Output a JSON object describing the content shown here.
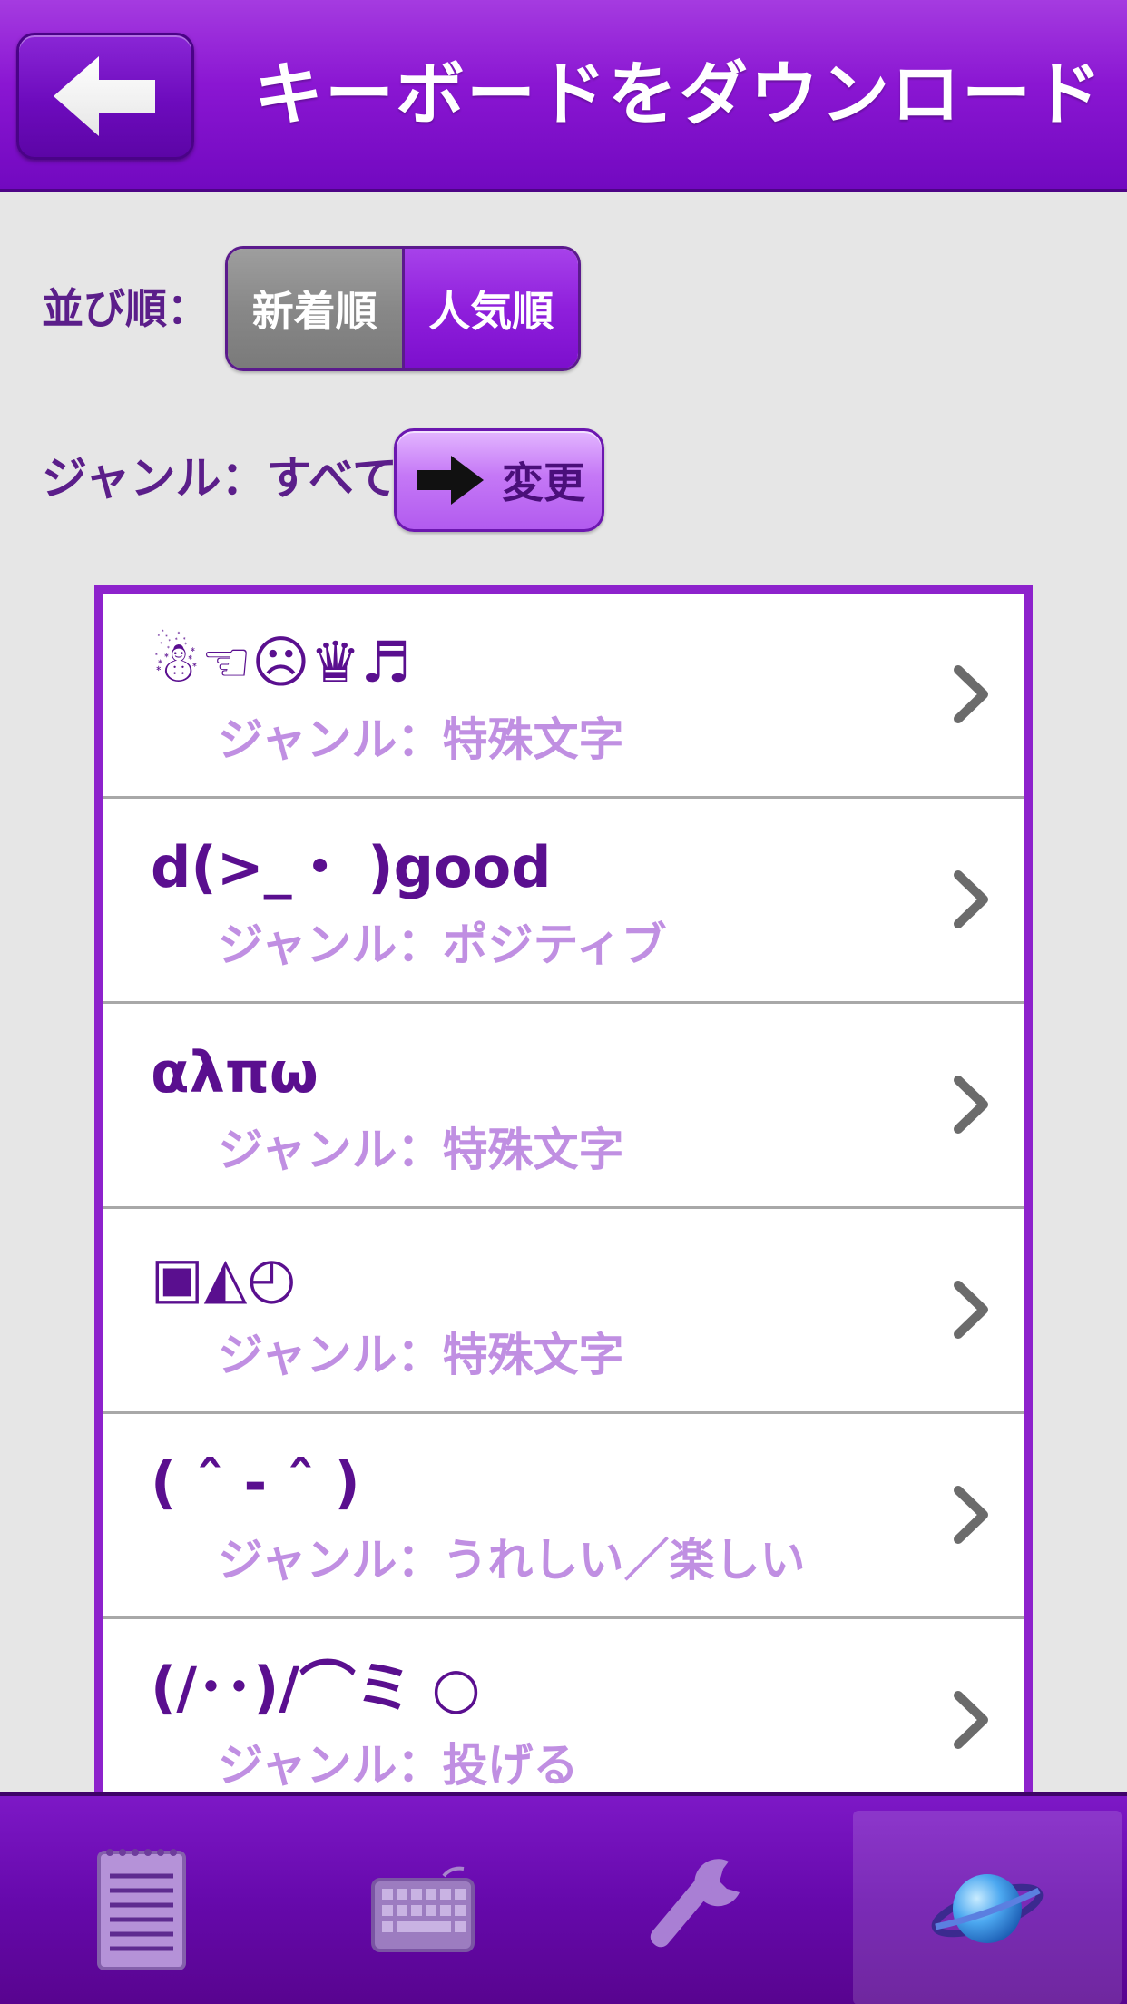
{
  "header": {
    "title": "キーボードをダウンロード",
    "back_icon": "back-arrow-icon"
  },
  "sort": {
    "label": "並び順：",
    "options": [
      "新着順",
      "人気順"
    ],
    "selected": "人気順"
  },
  "genre": {
    "label": "ジャンル：すべて",
    "change_label": "変更",
    "change_icon": "right-arrow-icon"
  },
  "keyboards": [
    {
      "title": "☃☜☹♛♬",
      "genre": "ジャンル：特殊文字"
    },
    {
      "title": "d(>_・ )good",
      "genre": "ジャンル：ポジティブ"
    },
    {
      "title": "αλπω",
      "genre": "ジャンル：特殊文字"
    },
    {
      "title": "▣◭◴",
      "genre": "ジャンル：特殊文字"
    },
    {
      "title": "( ˆ - ˆ )",
      "genre": "ジャンル：うれしい／楽しい"
    },
    {
      "title": "(/･･)/⌒ミ ○",
      "genre": "ジャンル：投げる"
    }
  ],
  "tabbar": {
    "tabs": [
      "notepad-icon",
      "keyboard-icon",
      "wrench-icon",
      "planet-icon"
    ],
    "active": "planet-icon"
  },
  "colors": {
    "brand_purple": "#8a16d2",
    "item_title": "#5a0f8f",
    "item_genre": "#c08fe2",
    "background": "#e6e6e6"
  }
}
